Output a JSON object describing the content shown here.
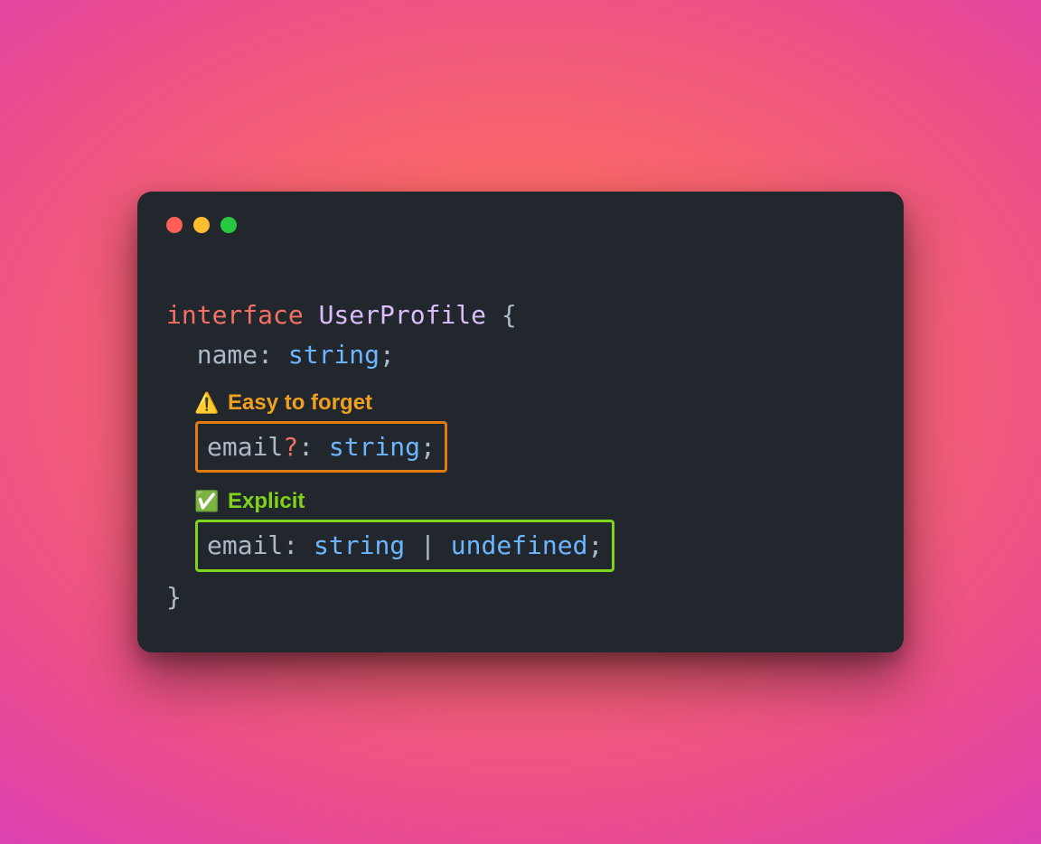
{
  "code": {
    "keyword": "interface",
    "typename": "UserProfile",
    "brace_open": "{",
    "brace_close": "}",
    "line1": {
      "prop": "name",
      "colon": ":",
      "type": "string",
      "semi": ";"
    },
    "warn_line": {
      "prop": "email",
      "opt": "?",
      "colon": ":",
      "type": "string",
      "semi": ";"
    },
    "ok_line": {
      "prop": "email",
      "colon": ":",
      "type1": "string",
      "pipe": "|",
      "type2": "undefined",
      "semi": ";"
    }
  },
  "annotations": {
    "warn": {
      "icon": "⚠️",
      "label": "Easy to forget"
    },
    "ok": {
      "icon": "✅",
      "label": "Explicit"
    }
  },
  "colors": {
    "window_bg": "#22272e",
    "warn_border": "#e17b10",
    "ok_border": "#7fd41b"
  }
}
